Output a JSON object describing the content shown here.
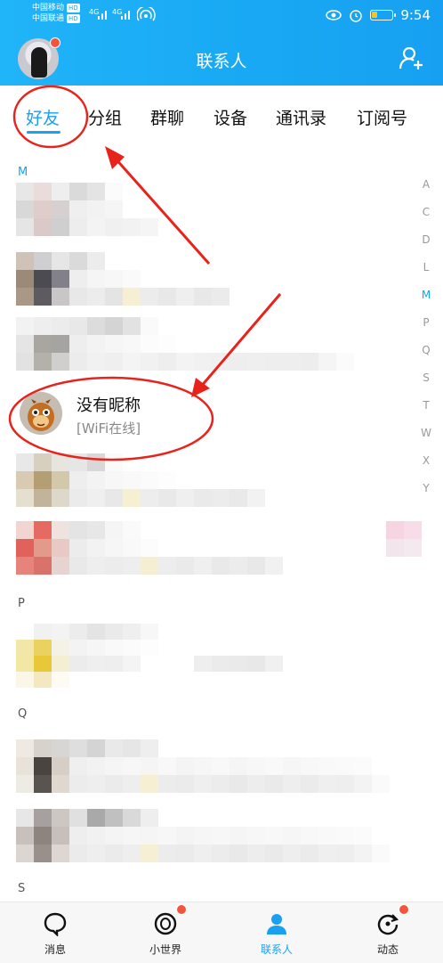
{
  "status_bar": {
    "carrier1": "中国移动",
    "carrier2": "中国联通",
    "hd": "HD",
    "sig1": "4G",
    "sig2": "4G",
    "time": "9:54"
  },
  "header": {
    "title": "联系人"
  },
  "tabs": [
    {
      "label": "好友",
      "active": true
    },
    {
      "label": "分组"
    },
    {
      "label": "群聊"
    },
    {
      "label": "设备"
    },
    {
      "label": "通讯录"
    },
    {
      "label": "订阅号"
    }
  ],
  "alphabet_index": [
    "A",
    "C",
    "D",
    "L",
    "M",
    "P",
    "Q",
    "S",
    "T",
    "W",
    "X",
    "Y"
  ],
  "alphabet_active": "M",
  "sections": {
    "m": "M",
    "p": "P",
    "q": "Q",
    "s": "S"
  },
  "friend": {
    "name": "没有昵称",
    "status": "[WiFi在线]"
  },
  "bottom_nav": [
    {
      "label": "消息",
      "icon": "message-icon"
    },
    {
      "label": "小世界",
      "icon": "small-world-icon",
      "badge": true
    },
    {
      "label": "联系人",
      "icon": "contacts-icon",
      "active": true
    },
    {
      "label": "动态",
      "icon": "moments-icon",
      "badge": true
    }
  ],
  "colors": {
    "accent": "#1aa0f0",
    "annotation": "#e8231b",
    "badge": "#f2553b"
  }
}
